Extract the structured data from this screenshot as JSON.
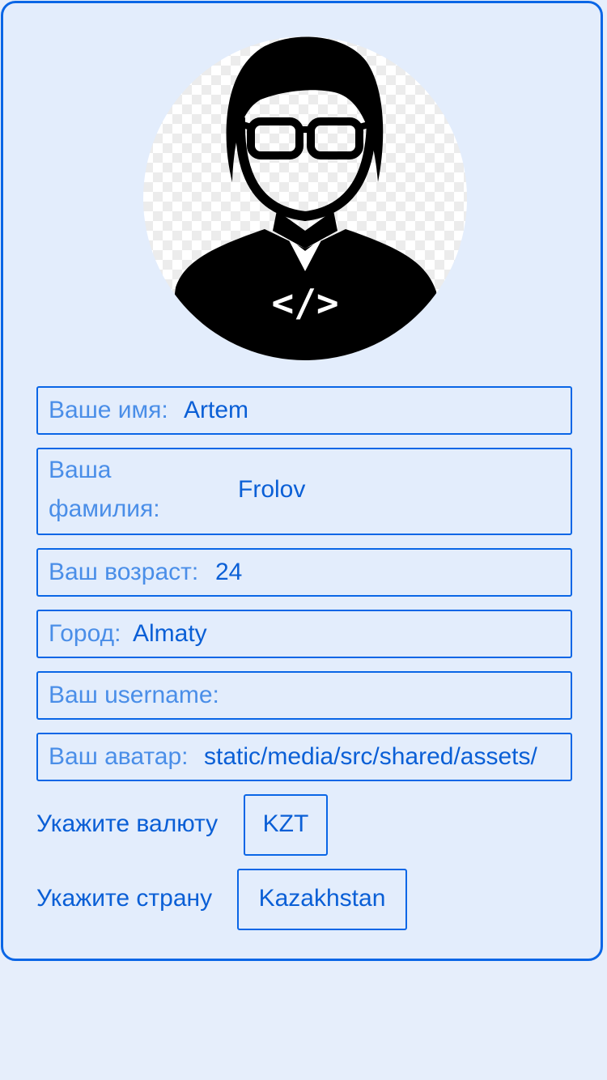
{
  "profile": {
    "avatar_icon": "developer-avatar-icon",
    "avatar_code_glyph": "</>",
    "fields": {
      "name": {
        "label": "Ваше имя:",
        "value": "Artem"
      },
      "surname": {
        "label": "Ваша фамилия:",
        "value": "Frolov"
      },
      "age": {
        "label": "Ваш возраст:",
        "value": "24"
      },
      "city": {
        "label": "Город:",
        "value": "Almaty"
      },
      "username": {
        "label": "Ваш username:",
        "value": ""
      },
      "avatar": {
        "label": "Ваш аватар:",
        "value": "static/media/src/shared/assets/"
      }
    },
    "currency": {
      "label": "Укажите валюту",
      "selected": "KZT"
    },
    "country": {
      "label": "Укажите страну",
      "selected": "Kazakhstan"
    }
  },
  "colors": {
    "accent": "#0a66e6",
    "label_text": "#4a8ee8",
    "value_text": "#0a5fd6",
    "background": "#e6eefb"
  }
}
